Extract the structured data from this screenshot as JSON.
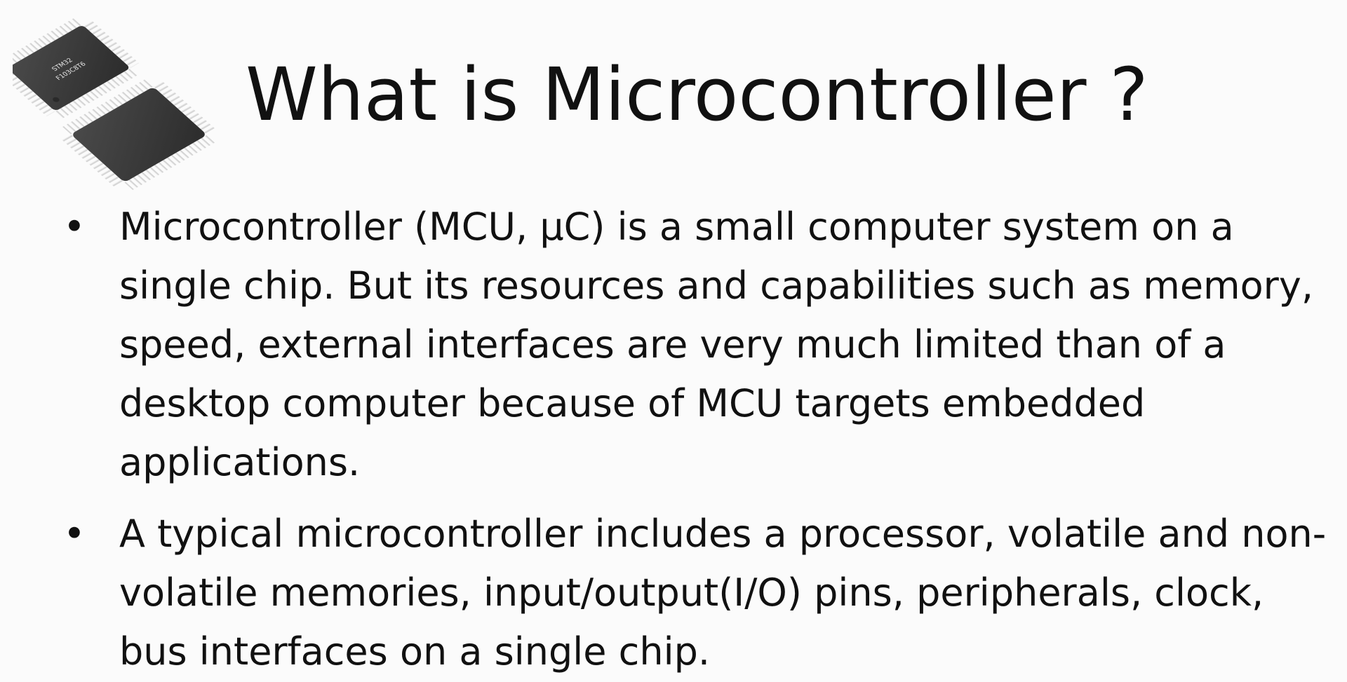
{
  "slide": {
    "title": "What is Microcontroller ?",
    "chip_marking": [
      "STM32",
      "F103C8T6"
    ],
    "bullets": [
      {
        "marker": "•",
        "text": "Microcontroller (MCU, µC) is a small computer system on a single chip. But its resources and capabilities such as memory, speed, external interfaces are very much limited than of a desktop computer because of MCU targets embedded applications."
      },
      {
        "marker": "•",
        "text": "A typical microcontroller includes a processor, volatile and non-volatile memories, input/output(I/O) pins, peripherals, clock, bus interfaces on a single chip."
      }
    ]
  },
  "colors": {
    "background": "#fbfbfb",
    "text": "#111111",
    "chip_body": "#3a3a3a",
    "chip_pins": "#cfcfcf"
  },
  "icons": [
    "microcontroller-chip-icon"
  ]
}
